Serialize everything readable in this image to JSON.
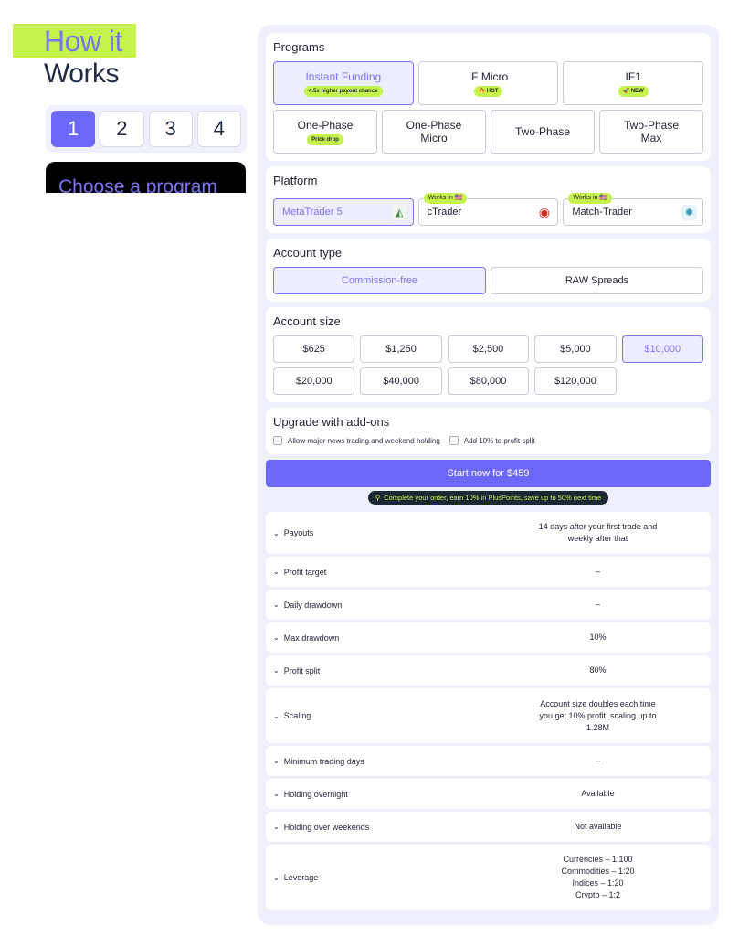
{
  "hero": {
    "line1": "How it",
    "line2": "Works"
  },
  "steps": [
    {
      "label": "1",
      "active": true
    },
    {
      "label": "2",
      "active": false
    },
    {
      "label": "3",
      "active": false
    },
    {
      "label": "4",
      "active": false
    }
  ],
  "choose_text": "Choose a program",
  "programs": {
    "title": "Programs",
    "row1": [
      {
        "label": "Instant Funding",
        "badge": "4.5x higher payout chance",
        "active": true
      },
      {
        "label": "IF Micro",
        "badge": "HOT",
        "active": false
      },
      {
        "label": "IF1",
        "badge": "NEW",
        "active": false
      }
    ],
    "row2": [
      {
        "label": "One-Phase",
        "badge": "Price drop",
        "active": false
      },
      {
        "label": "One-Phase\nMicro",
        "badge": "",
        "active": false
      },
      {
        "label": "Two-Phase",
        "badge": "",
        "active": false
      },
      {
        "label": "Two-Phase\nMax",
        "badge": "",
        "active": false
      }
    ]
  },
  "platform": {
    "title": "Platform",
    "items": [
      {
        "label": "MetaTrader 5",
        "badge": "",
        "icon": "metatrader-icon",
        "active": true
      },
      {
        "label": "cTrader",
        "badge": "Works in 🇺🇸",
        "icon": "ctrader-icon",
        "active": false
      },
      {
        "label": "Match-Trader",
        "badge": "Works in 🇺🇸",
        "icon": "match-trader-icon",
        "active": false
      }
    ]
  },
  "account_type": {
    "title": "Account type",
    "items": [
      {
        "label": "Commission-free",
        "active": true
      },
      {
        "label": "RAW Spreads",
        "active": false
      }
    ]
  },
  "account_size": {
    "title": "Account size",
    "items": [
      {
        "label": "$625",
        "active": false
      },
      {
        "label": "$1,250",
        "active": false
      },
      {
        "label": "$2,500",
        "active": false
      },
      {
        "label": "$5,000",
        "active": false
      },
      {
        "label": "$10,000",
        "active": true
      },
      {
        "label": "$20,000",
        "active": false
      },
      {
        "label": "$40,000",
        "active": false
      },
      {
        "label": "$80,000",
        "active": false
      },
      {
        "label": "$120,000",
        "active": false
      }
    ]
  },
  "addons": {
    "title": "Upgrade with add-ons",
    "items": [
      {
        "label": "Allow major news trading and weekend holding",
        "checked": false
      },
      {
        "label": "Add 10% to profit split",
        "checked": false
      }
    ]
  },
  "cta": {
    "label": "Start now for $459"
  },
  "promo": {
    "text": "Complete your order, earn 10% in PlusPoints, save up to 50% next time"
  },
  "details": [
    {
      "label": "Payouts",
      "value": "14 days after your first trade and\nweekly after that"
    },
    {
      "label": "Profit target",
      "value": "–"
    },
    {
      "label": "Daily drawdown",
      "value": "–"
    },
    {
      "label": "Max drawdown",
      "value": "10%"
    },
    {
      "label": "Profit split",
      "value": "80%"
    },
    {
      "label": "Scaling",
      "value": "Account size doubles each time\nyou get 10% profit, scaling up to\n1.28M"
    },
    {
      "label": "Minimum trading days",
      "value": "–"
    },
    {
      "label": "Holding overnight",
      "value": "Available"
    },
    {
      "label": "Holding over weekends",
      "value": "Not available"
    },
    {
      "label": "Leverage",
      "value": "Currencies – 1:100\nCommodities – 1:20\nIndices – 1:20\nCrypto – 1:2"
    }
  ],
  "colors": {
    "accent": "#6c67f6",
    "lime": "#c5f24b",
    "panel": "#eef0fb"
  }
}
